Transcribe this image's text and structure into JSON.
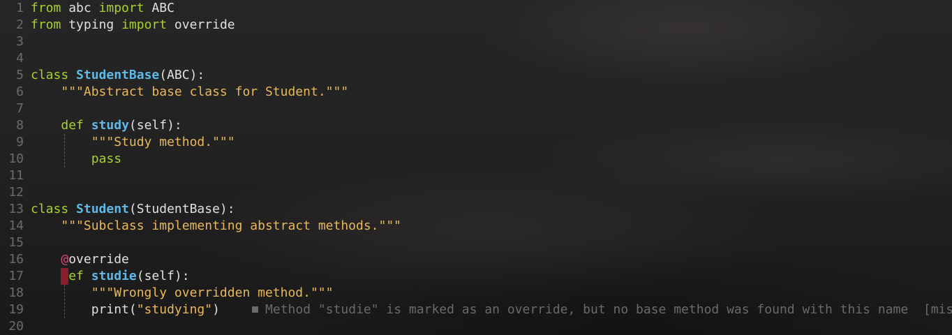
{
  "lines": [
    {
      "n": "1",
      "tokens": [
        {
          "k": "kw",
          "t": "from"
        },
        {
          "k": "plain",
          "t": " abc "
        },
        {
          "k": "kw",
          "t": "import"
        },
        {
          "k": "plain",
          "t": " ABC"
        }
      ]
    },
    {
      "n": "2",
      "tokens": [
        {
          "k": "kw",
          "t": "from"
        },
        {
          "k": "plain",
          "t": " typing "
        },
        {
          "k": "kw",
          "t": "import"
        },
        {
          "k": "plain",
          "t": " override"
        }
      ]
    },
    {
      "n": "3",
      "tokens": []
    },
    {
      "n": "4",
      "tokens": []
    },
    {
      "n": "5",
      "tokens": [
        {
          "k": "kw",
          "t": "class"
        },
        {
          "k": "plain",
          "t": " "
        },
        {
          "k": "cls",
          "t": "StudentBase"
        },
        {
          "k": "plain",
          "t": "(ABC):"
        }
      ]
    },
    {
      "n": "6",
      "tokens": [
        {
          "k": "plain",
          "t": "    "
        },
        {
          "k": "str",
          "t": "\"\"\"Abstract base class for Student.\"\"\""
        }
      ]
    },
    {
      "n": "7",
      "tokens": []
    },
    {
      "n": "8",
      "tokens": [
        {
          "k": "plain",
          "t": "    "
        },
        {
          "k": "kw",
          "t": "def"
        },
        {
          "k": "plain",
          "t": " "
        },
        {
          "k": "fn",
          "t": "study"
        },
        {
          "k": "plain",
          "t": "(self):"
        }
      ]
    },
    {
      "n": "9",
      "tokens": [
        {
          "k": "plain",
          "t": "        "
        },
        {
          "k": "str",
          "t": "\"\"\"Study method.\"\"\""
        }
      ]
    },
    {
      "n": "10",
      "tokens": [
        {
          "k": "plain",
          "t": "        "
        },
        {
          "k": "kw",
          "t": "pass"
        }
      ]
    },
    {
      "n": "11",
      "tokens": []
    },
    {
      "n": "12",
      "tokens": []
    },
    {
      "n": "13",
      "tokens": [
        {
          "k": "kw",
          "t": "class"
        },
        {
          "k": "plain",
          "t": " "
        },
        {
          "k": "cls",
          "t": "Student"
        },
        {
          "k": "plain",
          "t": "(StudentBase):"
        }
      ]
    },
    {
      "n": "14",
      "tokens": [
        {
          "k": "plain",
          "t": "    "
        },
        {
          "k": "str",
          "t": "\"\"\"Subclass implementing abstract methods.\"\"\""
        }
      ]
    },
    {
      "n": "15",
      "tokens": []
    },
    {
      "n": "16",
      "tokens": [
        {
          "k": "plain",
          "t": "    "
        },
        {
          "k": "dec-at",
          "t": "@"
        },
        {
          "k": "plain",
          "t": "override"
        }
      ]
    },
    {
      "n": "17",
      "tokens": [
        {
          "k": "plain",
          "t": "    "
        },
        {
          "k": "kw",
          "t": "def"
        },
        {
          "k": "plain",
          "t": " "
        },
        {
          "k": "fn",
          "t": "studie"
        },
        {
          "k": "plain",
          "t": "(self):"
        }
      ]
    },
    {
      "n": "18",
      "tokens": [
        {
          "k": "plain",
          "t": "        "
        },
        {
          "k": "str",
          "t": "\"\"\"Wrongly overridden method.\"\"\""
        }
      ]
    },
    {
      "n": "19",
      "tokens": [
        {
          "k": "plain",
          "t": "        print("
        },
        {
          "k": "str",
          "t": "\"studying\""
        },
        {
          "k": "plain",
          "t": ")"
        }
      ]
    },
    {
      "n": "20",
      "tokens": []
    }
  ],
  "diagnostic": {
    "line": "17",
    "message": "Method \"studie\" is marked as an override, but no base method was found with this name",
    "tag": "[misc]",
    "icon": "square-bullet-icon"
  },
  "colors": {
    "keyword": "#a6d12f",
    "class_name": "#5fb8e8",
    "string": "#e8b85a",
    "decorator_at": "#e0457f",
    "line_number": "#6b6b6b",
    "diagnostic": "#6a6a6a",
    "error_marker": "#8a1c2c"
  }
}
